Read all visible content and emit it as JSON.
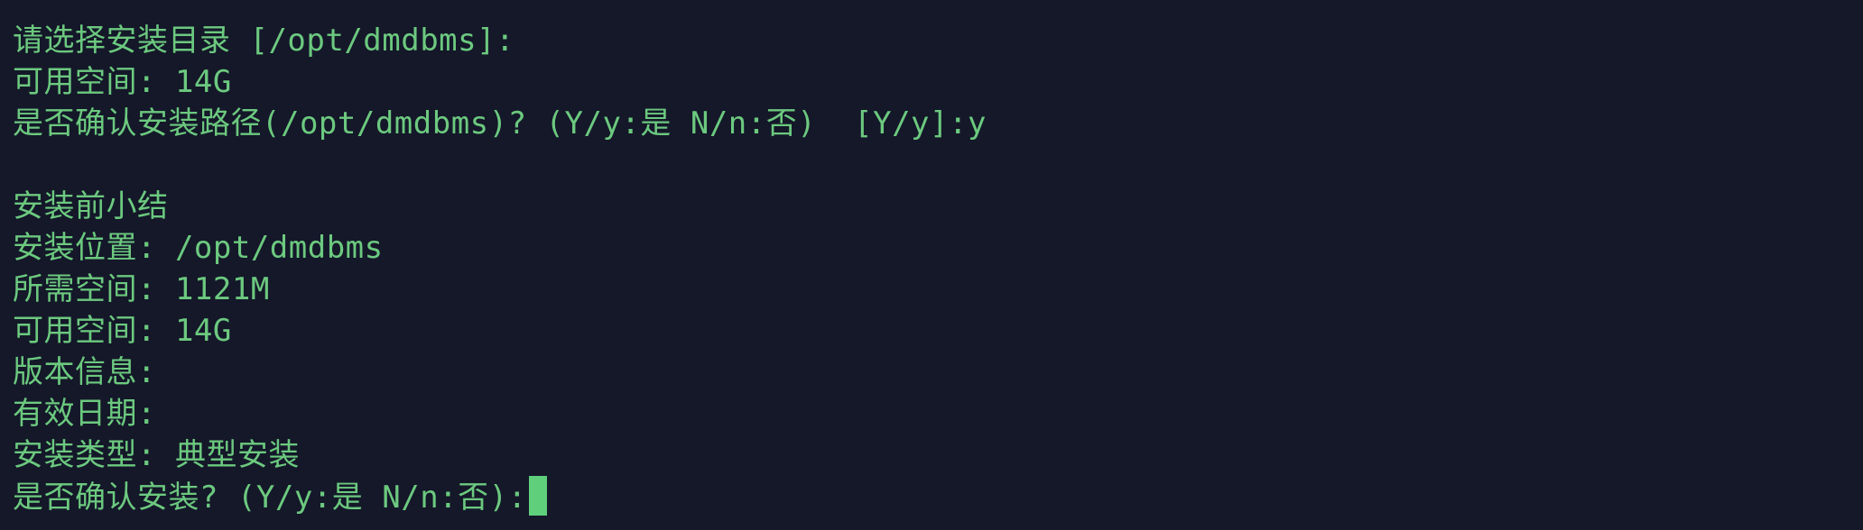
{
  "terminal": {
    "lines": [
      "请选择安装目录 [/opt/dmdbms]:",
      "可用空间: 14G",
      "是否确认安装路径(/opt/dmdbms)? (Y/y:是 N/n:否)  [Y/y]:y",
      "",
      "安装前小结",
      "安装位置: /opt/dmdbms",
      "所需空间: 1121M",
      "可用空间: 14G",
      "版本信息:",
      "有效日期:",
      "安装类型: 典型安装",
      "是否确认安装? (Y/y:是 N/n:否):"
    ],
    "colors": {
      "background": "#141829",
      "text": "#6cc97f",
      "cursor": "#5fcf7c"
    }
  }
}
